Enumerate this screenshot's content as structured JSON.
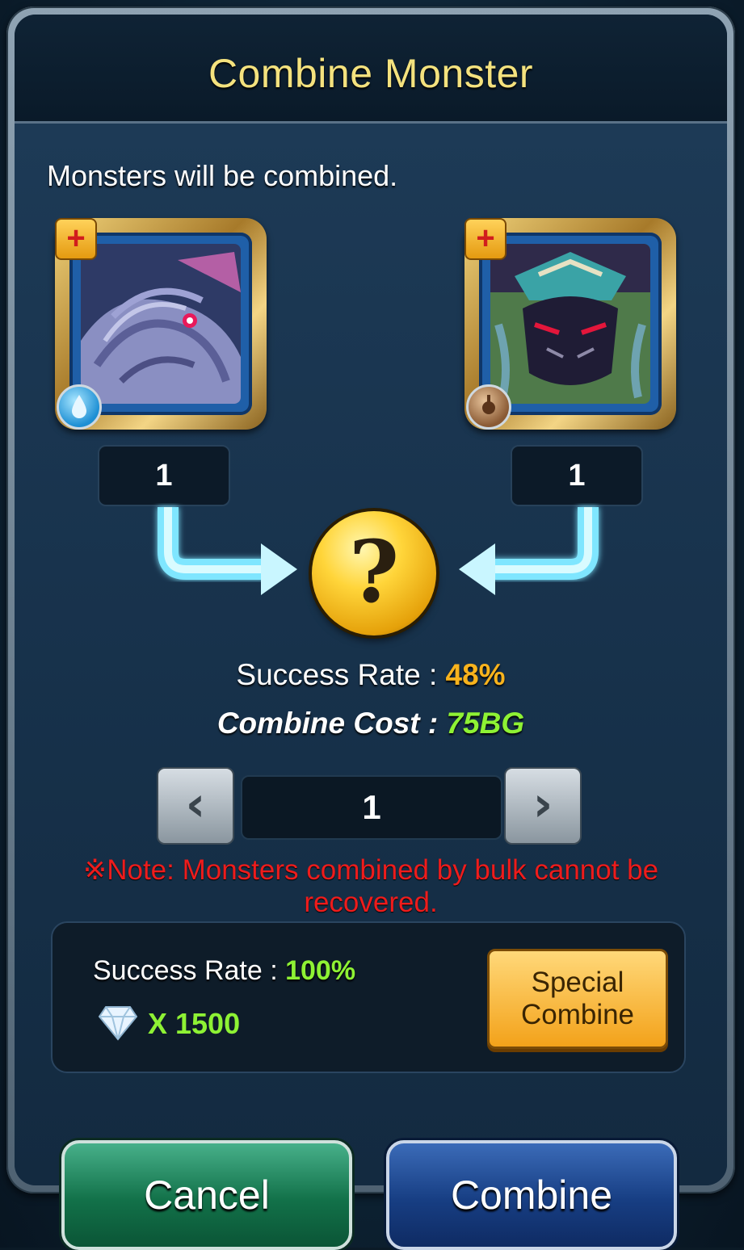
{
  "dialog": {
    "title": "Combine Monster",
    "message": "Monsters will be combined."
  },
  "monsters": [
    {
      "count": "1",
      "element": "water",
      "element_icon": "water-drop-icon"
    },
    {
      "count": "1",
      "element": "earth",
      "element_icon": "earth-bead-icon"
    }
  ],
  "result": {
    "icon": "question-mark-icon",
    "symbol": "?",
    "success_rate_label": "Success Rate :",
    "success_rate_value": "48%",
    "cost_label": "Combine Cost :",
    "cost_value": "75BG"
  },
  "stepper": {
    "value": "1",
    "decrease_icon": "chevron-left-icon",
    "decrease_symbol": "‹",
    "increase_icon": "chevron-right-icon",
    "increase_symbol": "›"
  },
  "note": "※Note: Monsters combined by bulk cannot be recovered.",
  "special": {
    "success_rate_label": "Success Rate :",
    "success_rate_value": "100%",
    "cost": "X 1500",
    "cost_icon": "diamond-gem-icon",
    "button_label": "Special Combine"
  },
  "footer": {
    "cancel_label": "Cancel",
    "combine_label": "Combine"
  },
  "plus_symbol": "+",
  "colors": {
    "title": "#f4e27e",
    "rate_yellow": "#f8b31d",
    "value_green": "#8ef234",
    "note_red": "#ee1c1c",
    "cancel_green": "#127149",
    "combine_blue": "#173e83",
    "special_orange": "#f3a21a"
  }
}
